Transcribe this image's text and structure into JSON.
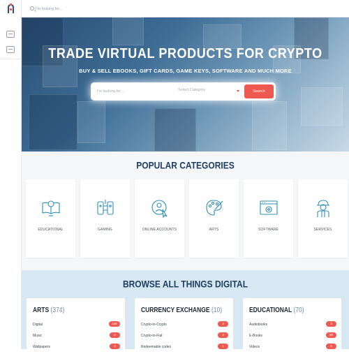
{
  "topbar": {
    "search_placeholder": "I'm looking for..."
  },
  "hero": {
    "title": "TRADE VIRTUAL PRODUCTS FOR CRYPTO",
    "subtitle": "BUY & SELL EBOOKS, GIFT CARDS, GAME KEYS, SOFTWARE AND MUCH MORE",
    "search_placeholder": "I'm looking for ...",
    "category_placeholder": "Select Category",
    "search_button": "Search"
  },
  "popular": {
    "title": "POPULAR CATEGORIES",
    "categories": [
      {
        "label": "EDUCATIONAL",
        "icon": "education-icon"
      },
      {
        "label": "GAMING",
        "icon": "gaming-icon"
      },
      {
        "label": "ONLINE ACCOUNTS",
        "icon": "online-accounts-icon"
      },
      {
        "label": "ARTS",
        "icon": "arts-icon"
      },
      {
        "label": "SOFTWARE",
        "icon": "software-icon"
      },
      {
        "label": "SERVICES",
        "icon": "services-icon"
      }
    ]
  },
  "browse": {
    "title": "BROWSE ALL THINGS DIGITAL",
    "groups": [
      {
        "name": "ARTS",
        "count": "(374)",
        "items": [
          {
            "label": "Digital",
            "count": "160"
          },
          {
            "label": "Music",
            "count": "2"
          },
          {
            "label": "Wallpapers",
            "count": "4"
          }
        ]
      },
      {
        "name": "CURRENCY EXCHANGE",
        "count": "(10)",
        "items": [
          {
            "label": "Crypto-to-Crypto",
            "count": "3"
          },
          {
            "label": "Crypto-to-Fiat",
            "count": "3"
          },
          {
            "label": "Redeemable codes",
            "count": "1"
          }
        ]
      },
      {
        "name": "EDUCATIONAL",
        "count": "(70)",
        "items": [
          {
            "label": "Audiobooks",
            "count": "3"
          },
          {
            "label": "E-Books",
            "count": "60"
          },
          {
            "label": "Videos",
            "count": "6"
          }
        ]
      }
    ]
  },
  "colors": {
    "accent": "#ef5a50",
    "heading": "#1e3f62",
    "icon": "#2d8fb5"
  }
}
